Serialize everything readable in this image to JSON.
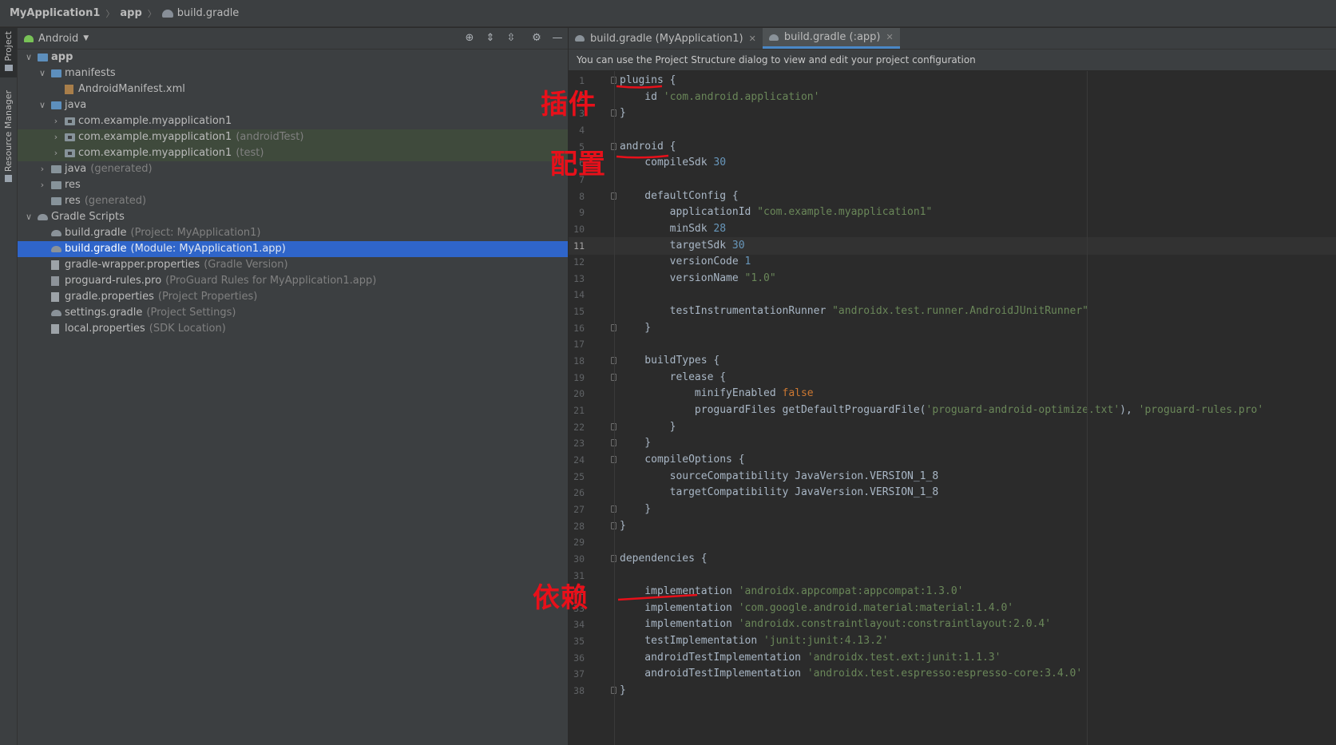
{
  "breadcrumb": {
    "project": "MyApplication1",
    "module": "app",
    "file": "build.gradle"
  },
  "side_strip": {
    "project_tab": "Project",
    "resource_tab": "Resource Manager"
  },
  "project_panel": {
    "view": "Android",
    "tree": [
      {
        "label": "app",
        "hint": "",
        "depth": 0,
        "arrow": "open",
        "icon": "folder-blue",
        "bold": true,
        "state": ""
      },
      {
        "label": "manifests",
        "hint": "",
        "depth": 1,
        "arrow": "open",
        "icon": "folder-blue",
        "state": ""
      },
      {
        "label": "AndroidManifest.xml",
        "hint": "",
        "depth": 2,
        "arrow": "",
        "icon": "xml",
        "state": ""
      },
      {
        "label": "java",
        "hint": "",
        "depth": 1,
        "arrow": "open",
        "icon": "folder-blue",
        "state": ""
      },
      {
        "label": "com.example.myapplication1",
        "hint": "",
        "depth": 2,
        "arrow": "closed",
        "icon": "pkg",
        "state": ""
      },
      {
        "label": "com.example.myapplication1",
        "hint": "(androidTest)",
        "depth": 2,
        "arrow": "closed",
        "icon": "pkg",
        "state": "green"
      },
      {
        "label": "com.example.myapplication1",
        "hint": "(test)",
        "depth": 2,
        "arrow": "closed",
        "icon": "pkg",
        "state": "green"
      },
      {
        "label": "java",
        "hint": "(generated)",
        "depth": 1,
        "arrow": "closed",
        "icon": "folder",
        "state": ""
      },
      {
        "label": "res",
        "hint": "",
        "depth": 1,
        "arrow": "closed",
        "icon": "folder",
        "state": ""
      },
      {
        "label": "res",
        "hint": "(generated)",
        "depth": 1,
        "arrow": "",
        "icon": "folder",
        "state": ""
      },
      {
        "label": "Gradle Scripts",
        "hint": "",
        "depth": 0,
        "arrow": "open",
        "icon": "elephant",
        "state": ""
      },
      {
        "label": "build.gradle",
        "hint": "(Project: MyApplication1)",
        "depth": 1,
        "arrow": "",
        "icon": "elephant",
        "state": ""
      },
      {
        "label": "build.gradle",
        "hint": "(Module: MyApplication1.app)",
        "depth": 1,
        "arrow": "",
        "icon": "elephant",
        "state": "selected"
      },
      {
        "label": "gradle-wrapper.properties",
        "hint": "(Gradle Version)",
        "depth": 1,
        "arrow": "",
        "icon": "props",
        "state": ""
      },
      {
        "label": "proguard-rules.pro",
        "hint": "(ProGuard Rules for MyApplication1.app)",
        "depth": 1,
        "arrow": "",
        "icon": "pro",
        "state": ""
      },
      {
        "label": "gradle.properties",
        "hint": "(Project Properties)",
        "depth": 1,
        "arrow": "",
        "icon": "props",
        "state": ""
      },
      {
        "label": "settings.gradle",
        "hint": "(Project Settings)",
        "depth": 1,
        "arrow": "",
        "icon": "elephant",
        "state": ""
      },
      {
        "label": "local.properties",
        "hint": "(SDK Location)",
        "depth": 1,
        "arrow": "",
        "icon": "props",
        "state": ""
      }
    ]
  },
  "editor": {
    "tabs": [
      {
        "label": "build.gradle (MyApplication1)",
        "active": false
      },
      {
        "label": "build.gradle (:app)",
        "active": true
      }
    ],
    "notice": "You can use the Project Structure dialog to view and edit your project configuration",
    "current_line": 11,
    "lines": [
      {
        "n": "1",
        "tokens": [
          [
            "plugins {",
            ""
          ]
        ]
      },
      {
        "n": "2",
        "tokens": [
          [
            "    id ",
            ""
          ],
          [
            "'com.android.application'",
            "str"
          ]
        ]
      },
      {
        "n": "3",
        "tokens": [
          [
            "}",
            ""
          ]
        ]
      },
      {
        "n": "4",
        "tokens": []
      },
      {
        "n": "5",
        "tokens": [
          [
            "android {",
            ""
          ]
        ]
      },
      {
        "n": "6",
        "tokens": [
          [
            "    compileSdk ",
            ""
          ],
          [
            "30",
            "num"
          ]
        ]
      },
      {
        "n": "7",
        "tokens": []
      },
      {
        "n": "8",
        "tokens": [
          [
            "    defaultConfig {",
            ""
          ]
        ]
      },
      {
        "n": "9",
        "tokens": [
          [
            "        applicationId ",
            ""
          ],
          [
            "\"com.example.myapplication1\"",
            "str"
          ]
        ]
      },
      {
        "n": "10",
        "tokens": [
          [
            "        minSdk ",
            ""
          ],
          [
            "28",
            "num"
          ]
        ]
      },
      {
        "n": "11",
        "tokens": [
          [
            "        targetSdk ",
            ""
          ],
          [
            "30",
            "num"
          ]
        ]
      },
      {
        "n": "12",
        "tokens": [
          [
            "        versionCode ",
            ""
          ],
          [
            "1",
            "num"
          ]
        ]
      },
      {
        "n": "13",
        "tokens": [
          [
            "        versionName ",
            ""
          ],
          [
            "\"1.0\"",
            "str"
          ]
        ]
      },
      {
        "n": "14",
        "tokens": []
      },
      {
        "n": "15",
        "tokens": [
          [
            "        testInstrumentationRunner ",
            ""
          ],
          [
            "\"androidx.test.runner.AndroidJUnitRunner\"",
            "str"
          ]
        ]
      },
      {
        "n": "16",
        "tokens": [
          [
            "    }",
            ""
          ]
        ]
      },
      {
        "n": "17",
        "tokens": []
      },
      {
        "n": "18",
        "tokens": [
          [
            "    buildTypes {",
            ""
          ]
        ]
      },
      {
        "n": "19",
        "tokens": [
          [
            "        release {",
            ""
          ]
        ]
      },
      {
        "n": "20",
        "tokens": [
          [
            "            minifyEnabled ",
            ""
          ],
          [
            "false",
            "kw"
          ]
        ]
      },
      {
        "n": "21",
        "tokens": [
          [
            "            proguardFiles getDefaultProguardFile(",
            ""
          ],
          [
            "'proguard-android-optimize.txt'",
            "str"
          ],
          [
            "), ",
            ""
          ],
          [
            "'proguard-rules.pro'",
            "str"
          ]
        ]
      },
      {
        "n": "22",
        "tokens": [
          [
            "        }",
            ""
          ]
        ]
      },
      {
        "n": "23",
        "tokens": [
          [
            "    }",
            ""
          ]
        ]
      },
      {
        "n": "24",
        "tokens": [
          [
            "    compileOptions {",
            ""
          ]
        ]
      },
      {
        "n": "25",
        "tokens": [
          [
            "        sourceCompatibility JavaVersion.VERSION_1_8",
            ""
          ]
        ]
      },
      {
        "n": "26",
        "tokens": [
          [
            "        targetCompatibility JavaVersion.VERSION_1_8",
            ""
          ]
        ]
      },
      {
        "n": "27",
        "tokens": [
          [
            "    }",
            ""
          ]
        ]
      },
      {
        "n": "28",
        "tokens": [
          [
            "}",
            ""
          ]
        ]
      },
      {
        "n": "29",
        "tokens": []
      },
      {
        "n": "30",
        "tokens": [
          [
            "dependencies {",
            ""
          ]
        ]
      },
      {
        "n": "31",
        "tokens": []
      },
      {
        "n": "32",
        "tokens": [
          [
            "    implementation ",
            ""
          ],
          [
            "'androidx.appcompat:appcompat:1.3.0'",
            "str"
          ]
        ]
      },
      {
        "n": "33",
        "tokens": [
          [
            "    implementation ",
            ""
          ],
          [
            "'com.google.android.material:material:1.4.0'",
            "str"
          ]
        ]
      },
      {
        "n": "34",
        "tokens": [
          [
            "    implementation ",
            ""
          ],
          [
            "'androidx.constraintlayout:constraintlayout:2.0.4'",
            "str"
          ]
        ]
      },
      {
        "n": "35",
        "tokens": [
          [
            "    testImplementation ",
            ""
          ],
          [
            "'junit:junit:4.13.2'",
            "str"
          ]
        ]
      },
      {
        "n": "36",
        "tokens": [
          [
            "    androidTestImplementation ",
            ""
          ],
          [
            "'androidx.test.ext:junit:1.1.3'",
            "str"
          ]
        ]
      },
      {
        "n": "37",
        "tokens": [
          [
            "    androidTestImplementation ",
            ""
          ],
          [
            "'androidx.test.espresso:espresso-core:3.4.0'",
            "str"
          ]
        ]
      },
      {
        "n": "38",
        "tokens": [
          [
            "}",
            ""
          ]
        ]
      }
    ],
    "fold_lines": [
      "1",
      "3",
      "5",
      "8",
      "16",
      "18",
      "19",
      "22",
      "23",
      "24",
      "27",
      "28",
      "30",
      "38"
    ]
  },
  "annotations": {
    "plugins": "插件",
    "android": "配置",
    "dependencies": "依赖"
  },
  "colors": {
    "annotation": "#e8101a",
    "selection": "#2f65ca",
    "string": "#6a8759",
    "number": "#6897bb",
    "keyword": "#cc7832"
  }
}
